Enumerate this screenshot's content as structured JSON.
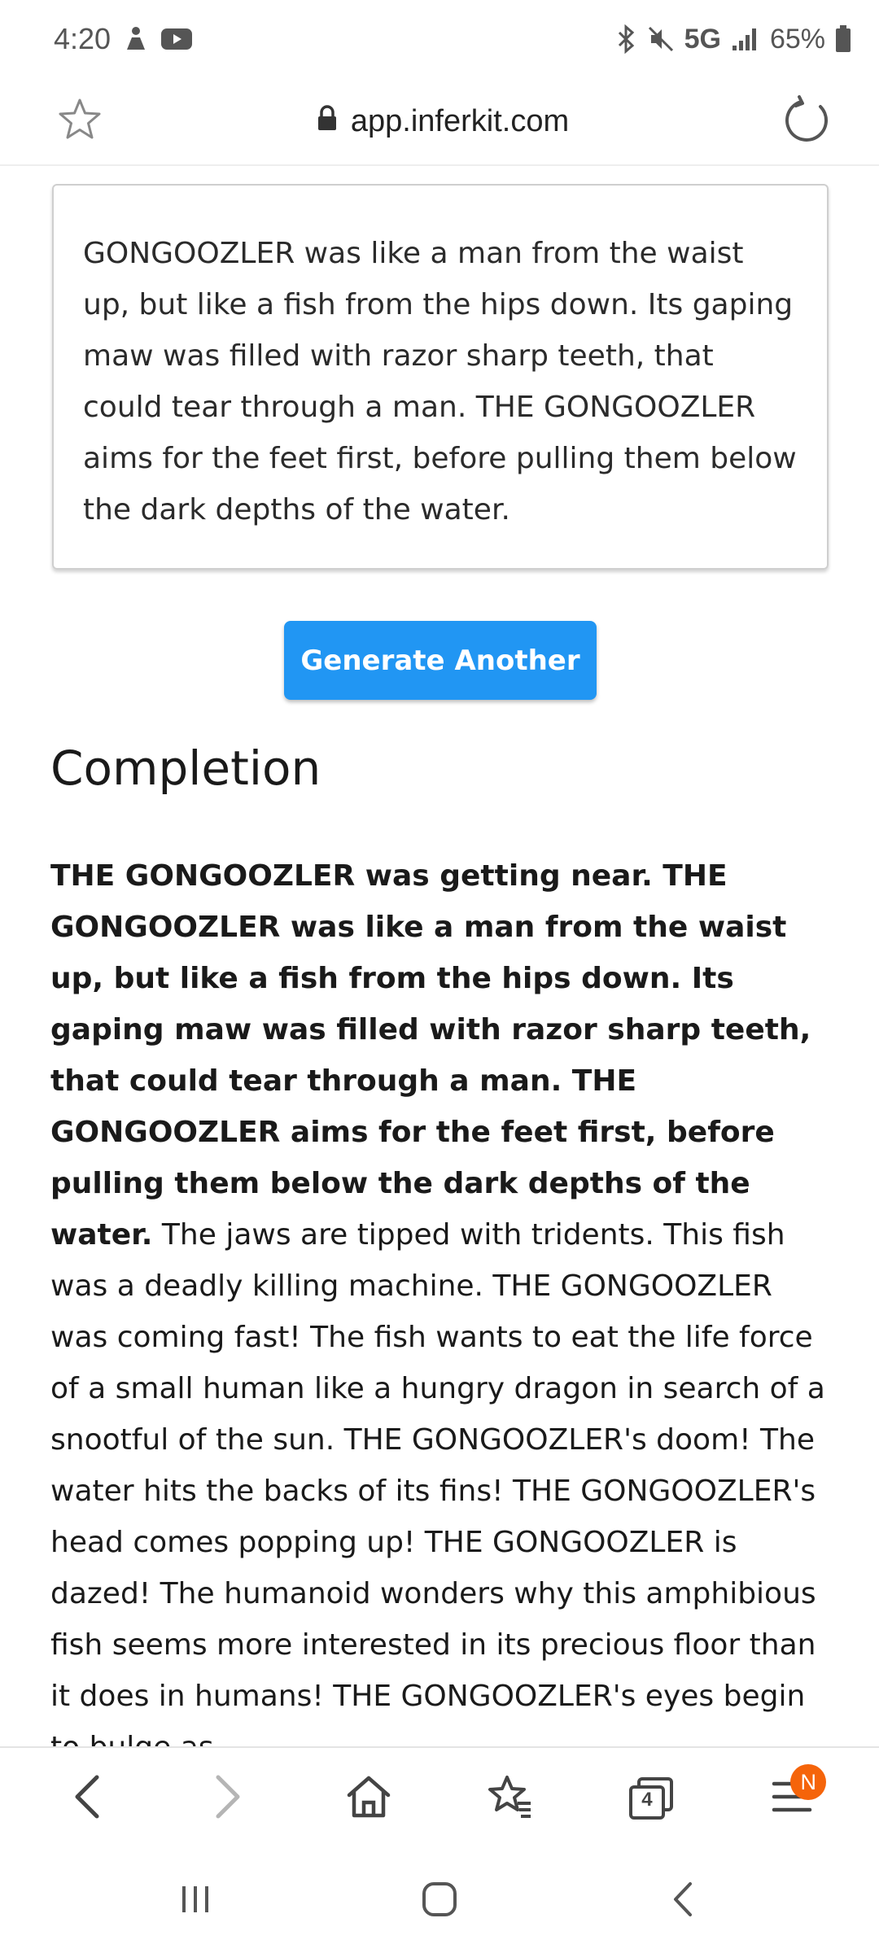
{
  "status_bar": {
    "time": "4:20",
    "network": "5G",
    "battery": "65%"
  },
  "browser": {
    "url": "app.inferkit.com",
    "tab_count": "4",
    "menu_badge": "N"
  },
  "prompt": {
    "text": "GONGOOZLER was like a man from the waist up, but like a fish from the hips down. Its gaping maw was filled with razor sharp teeth, that could tear through a man. THE GONGOOZLER aims for the feet first, before pulling them below the dark depths of the water."
  },
  "generate_button": {
    "label": "Generate Another"
  },
  "completion": {
    "heading": "Completion",
    "prompt_part": "THE GONGOOZLER was getting near. THE GONGOOZLER was like a man from the waist up, but like a fish from the hips down. Its gaping maw was filled with razor sharp teeth, that could tear through a man. THE GONGOOZLER aims for the feet first, before pulling them below the dark depths of the water.",
    "generated_part": " The jaws are tipped with tridents. This fish was a deadly killing machine. THE GONGOOZLER was coming fast! The fish wants to eat the life force of a small human like a hungry dragon in search of a snootful of the sun. THE GONGOOZLER's doom! The water hits the backs of its fins! THE GONGOOZLER's head comes popping up! THE GONGOOZLER is dazed! The humanoid wonders why this amphibious fish seems more interested in its precious floor than it does in humans! THE GONGOOZLER's eyes begin to bulge as"
  },
  "colors": {
    "accent": "#2196f3",
    "badge": "#f5640a"
  },
  "icons": {
    "status_left": [
      "person-icon",
      "youtube-icon"
    ],
    "status_right": [
      "bluetooth-icon",
      "mute-icon",
      "signal-icon",
      "battery-icon"
    ],
    "address_bar": [
      "star-icon",
      "lock-icon",
      "reload-icon"
    ],
    "toolbar": [
      "back-icon",
      "forward-icon",
      "home-icon",
      "bookmarks-icon",
      "tabs-icon",
      "menu-icon"
    ],
    "system_nav": [
      "recents-icon",
      "home-nav-icon",
      "back-nav-icon"
    ]
  }
}
